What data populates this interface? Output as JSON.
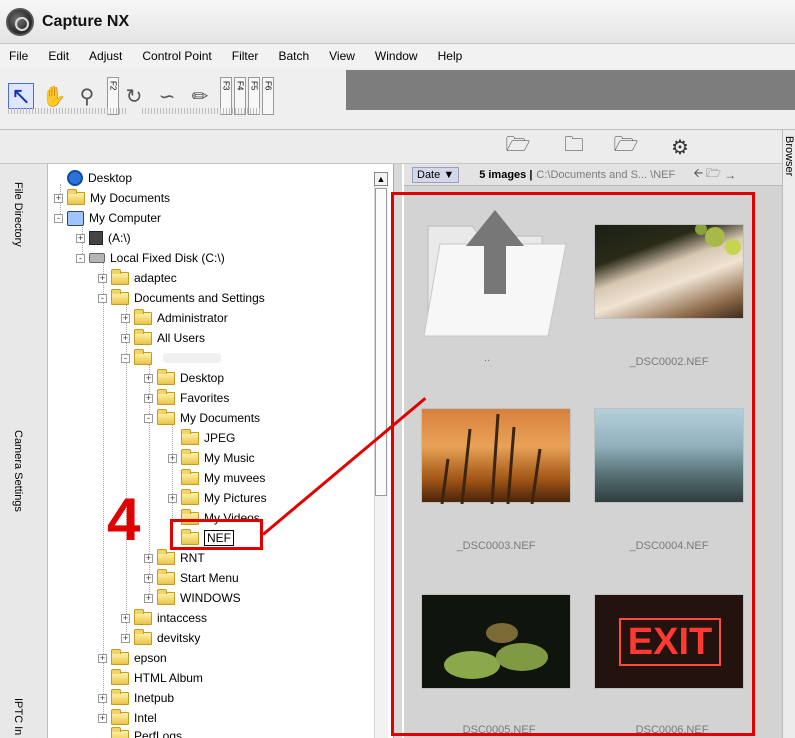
{
  "app": {
    "title": "Capture NX"
  },
  "menu": [
    "File",
    "Edit",
    "Adjust",
    "Control Point",
    "Filter",
    "Batch",
    "View",
    "Window",
    "Help"
  ],
  "toolbar": {
    "tools": [
      "select-arrow-icon",
      "hand-icon",
      "zoom-icon",
      "rotate-icon",
      "straighten-icon",
      "crop-icon"
    ],
    "fkeys": [
      "F2",
      "F3",
      "F4",
      "F5",
      "F6"
    ]
  },
  "browser_tools": [
    "open-folder-icon",
    "open-image-icon",
    "open-file-icon",
    "settings-icon"
  ],
  "side_tabs": [
    "File Directory",
    "Camera Settings",
    "IPTC In"
  ],
  "tree": [
    {
      "label": "Desktop"
    },
    {
      "label": "My Documents"
    },
    {
      "label": "My Computer"
    },
    {
      "label": "(A:\\)"
    },
    {
      "label": "Local Fixed Disk (C:\\)"
    },
    {
      "label": "adaptec"
    },
    {
      "label": "Documents and Settings"
    },
    {
      "label": "Administrator"
    },
    {
      "label": "All Users"
    },
    {
      "label": ""
    },
    {
      "label": "Desktop"
    },
    {
      "label": "Favorites"
    },
    {
      "label": "My Documents"
    },
    {
      "label": "JPEG"
    },
    {
      "label": "My Music"
    },
    {
      "label": "My muvees"
    },
    {
      "label": "My Pictures"
    },
    {
      "label": "My Videos"
    },
    {
      "label": "NEF"
    },
    {
      "label": "RNT"
    },
    {
      "label": "Start Menu"
    },
    {
      "label": "WINDOWS"
    },
    {
      "label": "intaccess"
    },
    {
      "label": "devitsky"
    },
    {
      "label": "epson"
    },
    {
      "label": "HTML Album"
    },
    {
      "label": "Inetpub"
    },
    {
      "label": "Intel"
    },
    {
      "label": "PerfLogs"
    }
  ],
  "browser": {
    "sort_label": "Date",
    "image_count": "5 images |",
    "path": "C:\\Documents and S... \\NEF",
    "up_label": "..",
    "images": [
      {
        "name": "_DSC0002.NEF"
      },
      {
        "name": "_DSC0003.NEF"
      },
      {
        "name": "_DSC0004.NEF"
      },
      {
        "name": "_DSC0005.NEF"
      },
      {
        "name": "_DSC0006.NEF"
      }
    ],
    "exit_sign": "EXIT"
  },
  "right_tab": "Browser",
  "annotation": {
    "step": "4",
    "color": "#e00000"
  }
}
